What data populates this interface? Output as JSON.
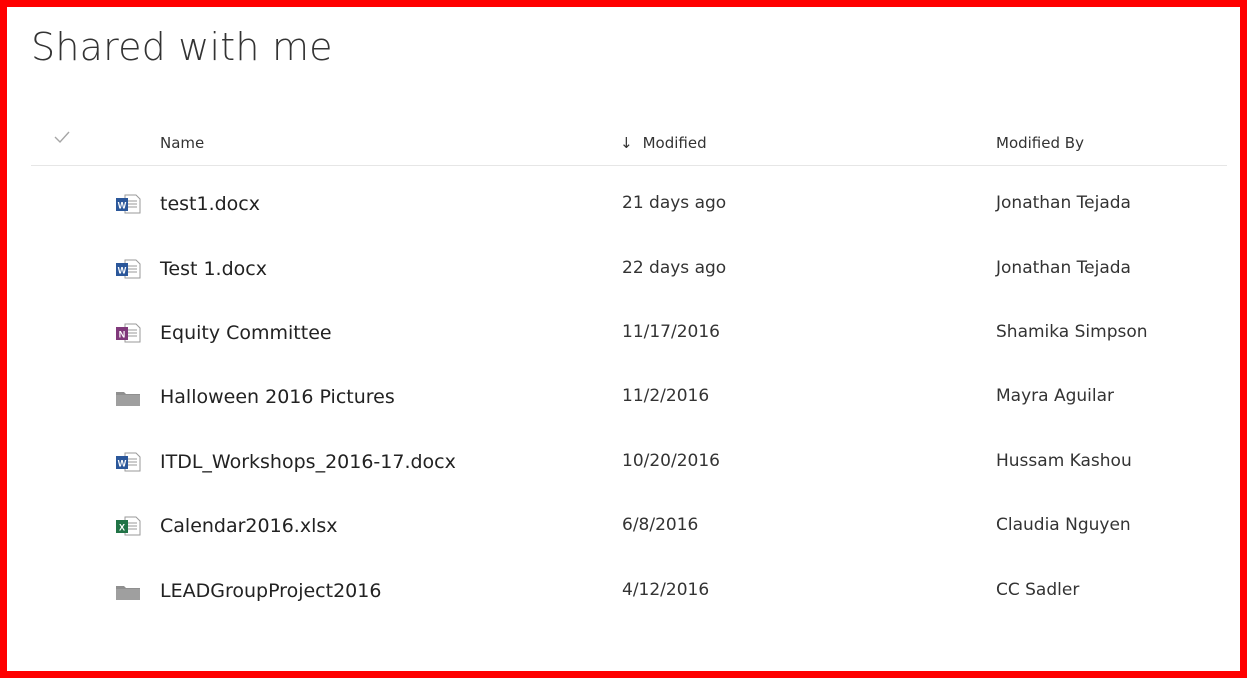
{
  "page": {
    "title": "Shared with me"
  },
  "columns": {
    "name": "Name",
    "modified": "Modified",
    "modified_by": "Modified By",
    "sort_arrow": "↓"
  },
  "colors": {
    "frame": "#ff0000",
    "word": "#2b579a",
    "onenote": "#80397b",
    "excel": "#217346",
    "folder": "#8f8f8f"
  },
  "rows": [
    {
      "icon": "word-file-icon",
      "name": "test1.docx",
      "modified": "21 days ago",
      "modified_by": "Jonathan Tejada"
    },
    {
      "icon": "word-file-icon",
      "name": "Test 1.docx",
      "modified": "22 days ago",
      "modified_by": "Jonathan Tejada"
    },
    {
      "icon": "onenote-file-icon",
      "name": "Equity Committee",
      "modified": "11/17/2016",
      "modified_by": "Shamika Simpson"
    },
    {
      "icon": "folder-icon",
      "name": "Halloween 2016 Pictures",
      "modified": "11/2/2016",
      "modified_by": "Mayra Aguilar"
    },
    {
      "icon": "word-file-icon",
      "name": "ITDL_Workshops_2016-17.docx",
      "modified": "10/20/2016",
      "modified_by": "Hussam Kashou"
    },
    {
      "icon": "excel-file-icon",
      "name": "Calendar2016.xlsx",
      "modified": "6/8/2016",
      "modified_by": "Claudia Nguyen"
    },
    {
      "icon": "folder-icon",
      "name": "LEADGroupProject2016",
      "modified": "4/12/2016",
      "modified_by": "CC Sadler"
    }
  ]
}
